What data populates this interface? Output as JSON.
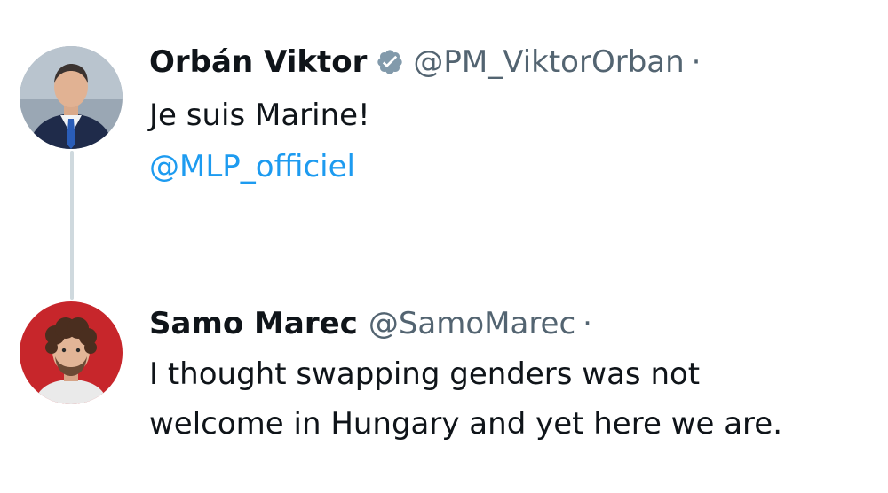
{
  "tweets": [
    {
      "display_name": "Orbán Viktor",
      "handle": "@PM_ViktorOrban",
      "separator": "·",
      "verified": true,
      "text": "Je suis Marine!",
      "mention": "@MLP_officiel"
    },
    {
      "display_name": "Samo Marec",
      "handle": "@SamoMarec",
      "separator": "·",
      "verified": false,
      "text_line_1": "I thought swapping genders was not",
      "text_line_2": "welcome in Hungary and yet here we are."
    }
  ],
  "colors": {
    "text": "#0f1419",
    "secondary": "#536471",
    "link": "#1d9bf0",
    "verified_badge": "#829aab",
    "thread_line": "#cfd9de"
  },
  "icons": {
    "verified": "verified-badge-icon"
  }
}
